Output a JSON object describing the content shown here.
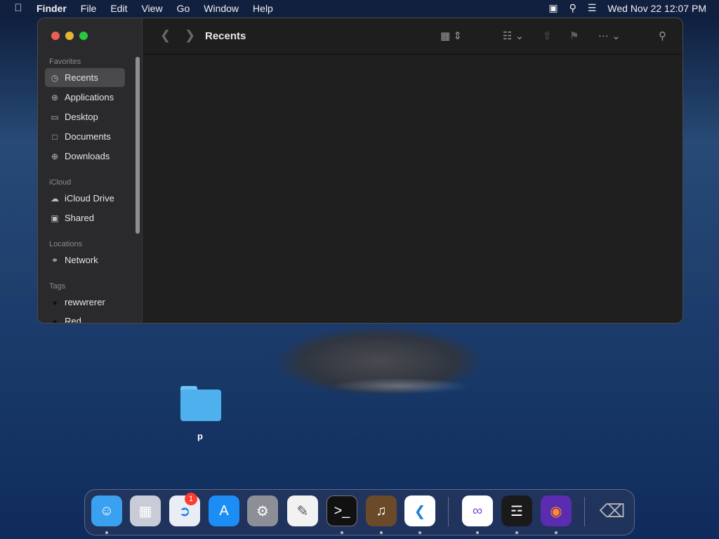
{
  "menubar": {
    "apple_icon": "apple-logo",
    "app_name": "Finder",
    "items": [
      "File",
      "Edit",
      "View",
      "Go",
      "Window",
      "Help"
    ],
    "clock": "Wed Nov 22  12:07 PM"
  },
  "finder": {
    "title": "Recents",
    "sidebar": {
      "favorites_title": "Favorites",
      "favorites": [
        "Recents",
        "Applications",
        "Desktop",
        "Documents",
        "Downloads"
      ],
      "icloud_title": "iCloud",
      "icloud": [
        "iCloud Drive",
        "Shared"
      ],
      "locations_title": "Locations",
      "locations": [
        "Network"
      ],
      "tags_title": "Tags",
      "tags": [
        "rewwrerer",
        "Red"
      ]
    }
  },
  "desktop": {
    "folder_label": "p"
  },
  "dock": {
    "settings_badge": "1",
    "apps": [
      "Finder",
      "Launchpad",
      "Safari",
      "App Store",
      "System Settings",
      "TextEdit",
      "Terminal",
      "GarageBand",
      "Visual Studio Code",
      "Visual Studio",
      "Piano",
      "Firefox",
      "Trash"
    ]
  },
  "colors": {
    "close": "#ec5f57",
    "minimize": "#e4b634",
    "maximize": "#27c93f",
    "selection": "#4a4a4c",
    "badge": "#ff3b30"
  }
}
